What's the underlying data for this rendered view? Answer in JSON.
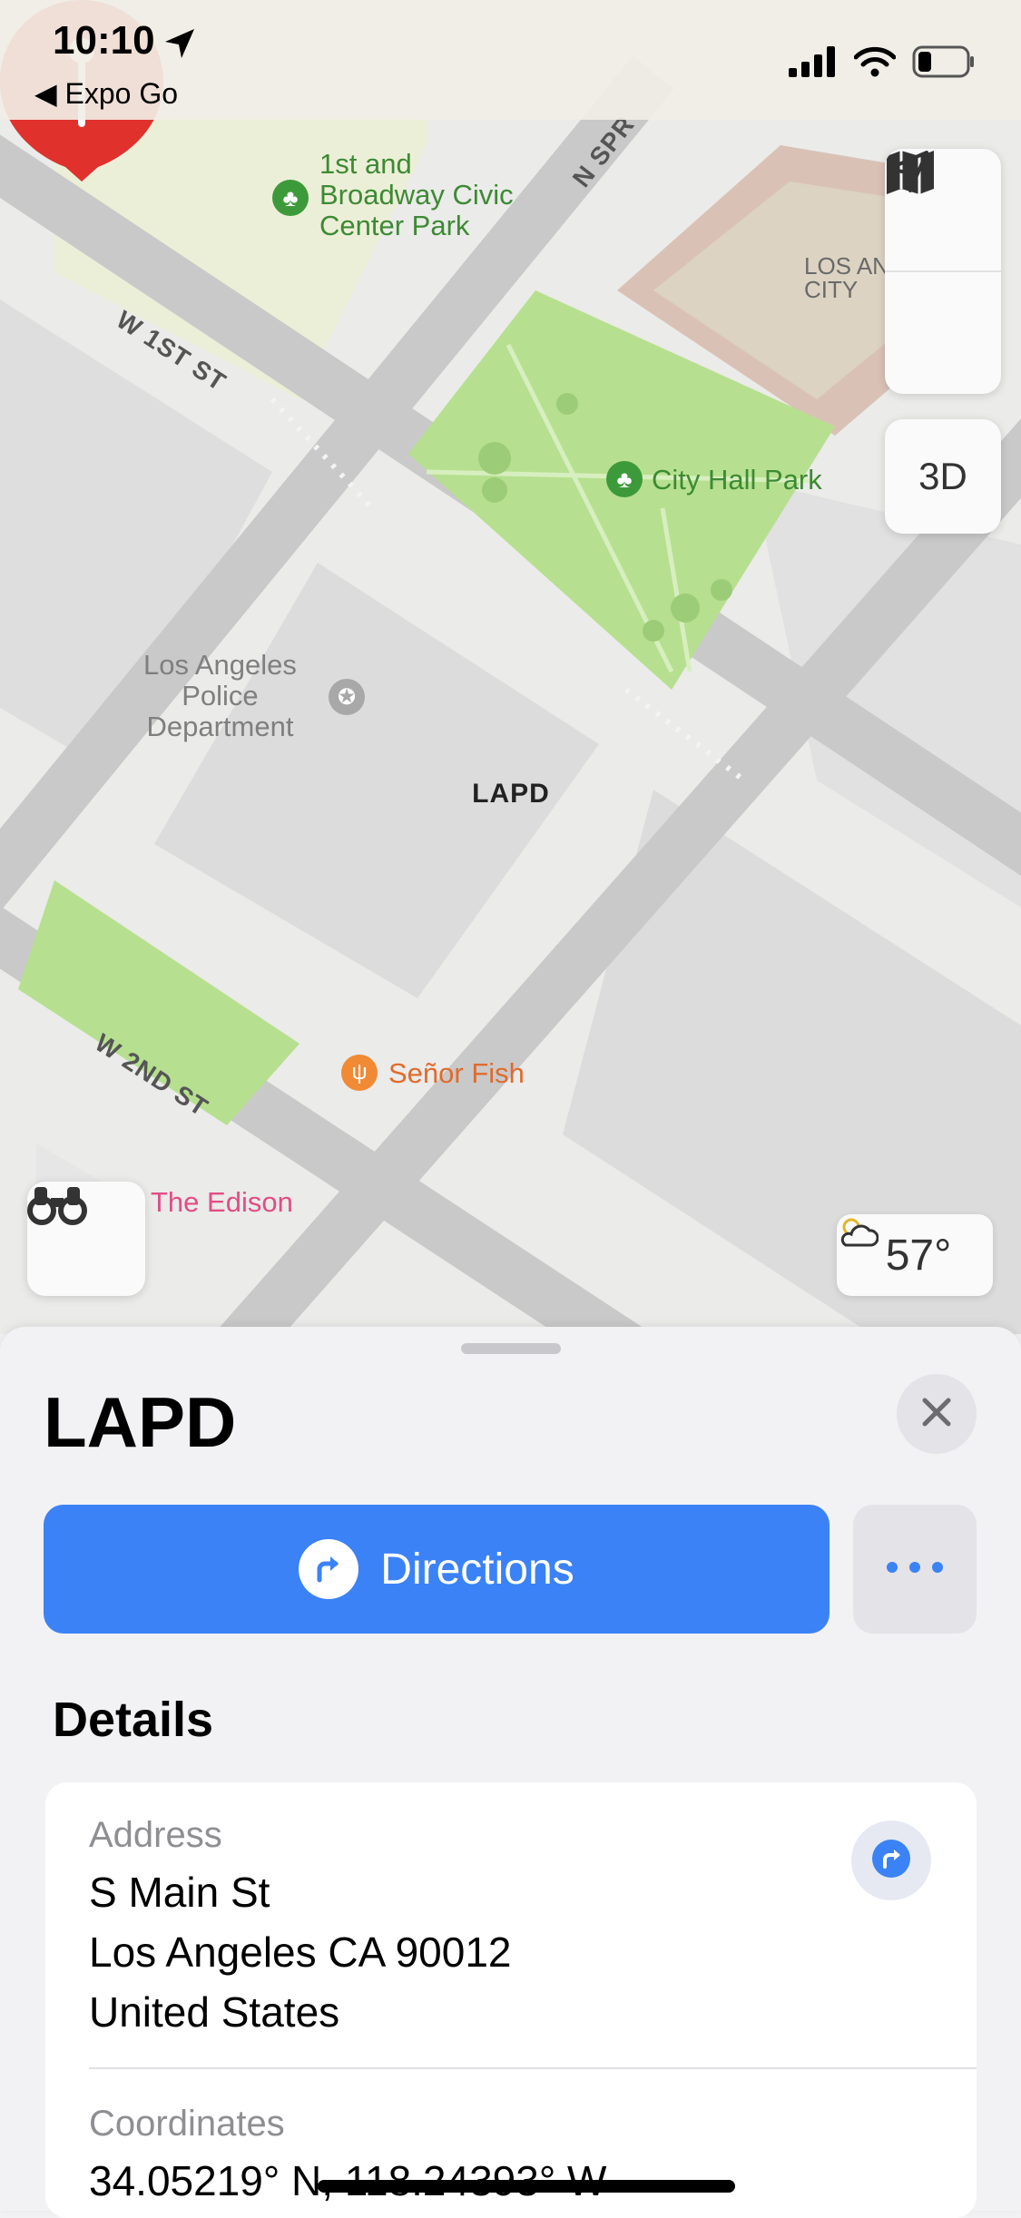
{
  "status_bar": {
    "time": "10:10",
    "back_app": "◀ Expo Go"
  },
  "map": {
    "labels": {
      "park1": "1st and\nBroadway Civic\nCenter Park",
      "city_hall_park": "City Hall Park",
      "street_w1st": "W 1ST ST",
      "street_w2nd": "W 2ND ST",
      "street_nspr": "N SPR",
      "lapd_building": "Los Angeles\nPolice\nDepartment",
      "senor_fish": "Señor Fish",
      "the_edison": "The Edison",
      "los_angeles_city": "LOS AN\nCITY"
    },
    "pin_label": "LAPD",
    "controls": {
      "three_d": "3D"
    },
    "weather": {
      "temperature": "57°",
      "icon": "partly-cloudy-icon"
    }
  },
  "sheet": {
    "title": "LAPD",
    "directions_label": "Directions",
    "details_heading": "Details",
    "address": {
      "label": "Address",
      "line1": "S Main St",
      "line2": "Los Angeles CA 90012",
      "line3": "United States"
    },
    "coordinates": {
      "label": "Coordinates",
      "value": "34.05219° N, 118.24393° W"
    }
  },
  "colors": {
    "accent": "#3b82f6",
    "pin": "#e0312d",
    "park": "#b6e08f"
  }
}
